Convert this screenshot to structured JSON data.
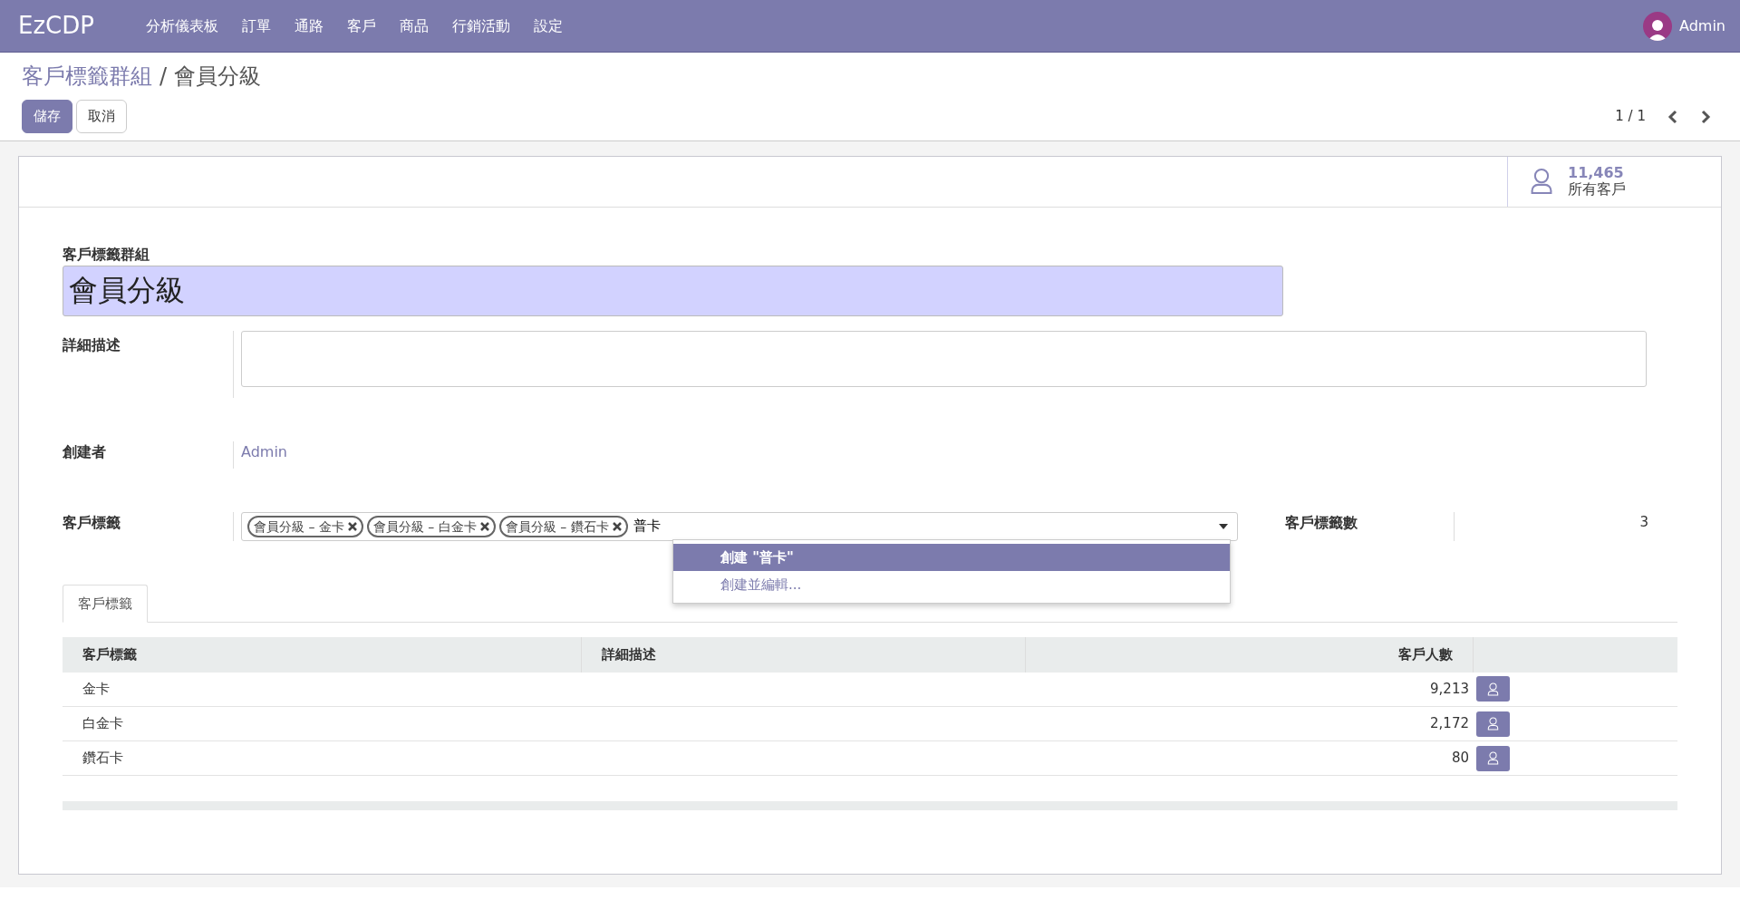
{
  "navbar": {
    "brand": "EzCDP",
    "menu": [
      "分析儀表板",
      "訂單",
      "通路",
      "客戶",
      "商品",
      "行銷活動",
      "設定"
    ],
    "user": "Admin"
  },
  "breadcrumb": {
    "parent": "客戶標籤群組",
    "separator": "/",
    "current": "會員分級"
  },
  "buttons": [
    {
      "label": "儲存",
      "kind": "primary"
    },
    {
      "label": "取消",
      "kind": "secondary"
    }
  ],
  "pager": "1 / 1",
  "stat_button": {
    "value": "11,465",
    "label": "所有客戶"
  },
  "form": {
    "name_label": "客戶標籤群組",
    "name_value": "會員分級",
    "description_label": "詳細描述",
    "creator_label": "創建者",
    "creator_value": "Admin",
    "tags_label": "客戶標籤",
    "tags": [
      "會員分級 – 金卡",
      "會員分級 – 白金卡",
      "會員分級 – 鑽石卡"
    ],
    "tags_input": "普卡",
    "tag_count_label": "客戶標籤數",
    "tag_count_value": "3"
  },
  "dropdown": [
    {
      "label": "創建 \"普卡\"",
      "selected": true
    },
    {
      "label": "創建並編輯...",
      "selected": false
    }
  ],
  "tabs": [
    {
      "label": "客戶標籤",
      "selected": true
    }
  ],
  "table": {
    "columns": [
      "客戶標籤",
      "詳細描述",
      "客戶人數"
    ],
    "rows": [
      {
        "name": "金卡",
        "description": "",
        "count": "9,213"
      },
      {
        "name": "白金卡",
        "description": "",
        "count": "2,172"
      },
      {
        "name": "鑽石卡",
        "description": "",
        "count": "80"
      }
    ]
  }
}
